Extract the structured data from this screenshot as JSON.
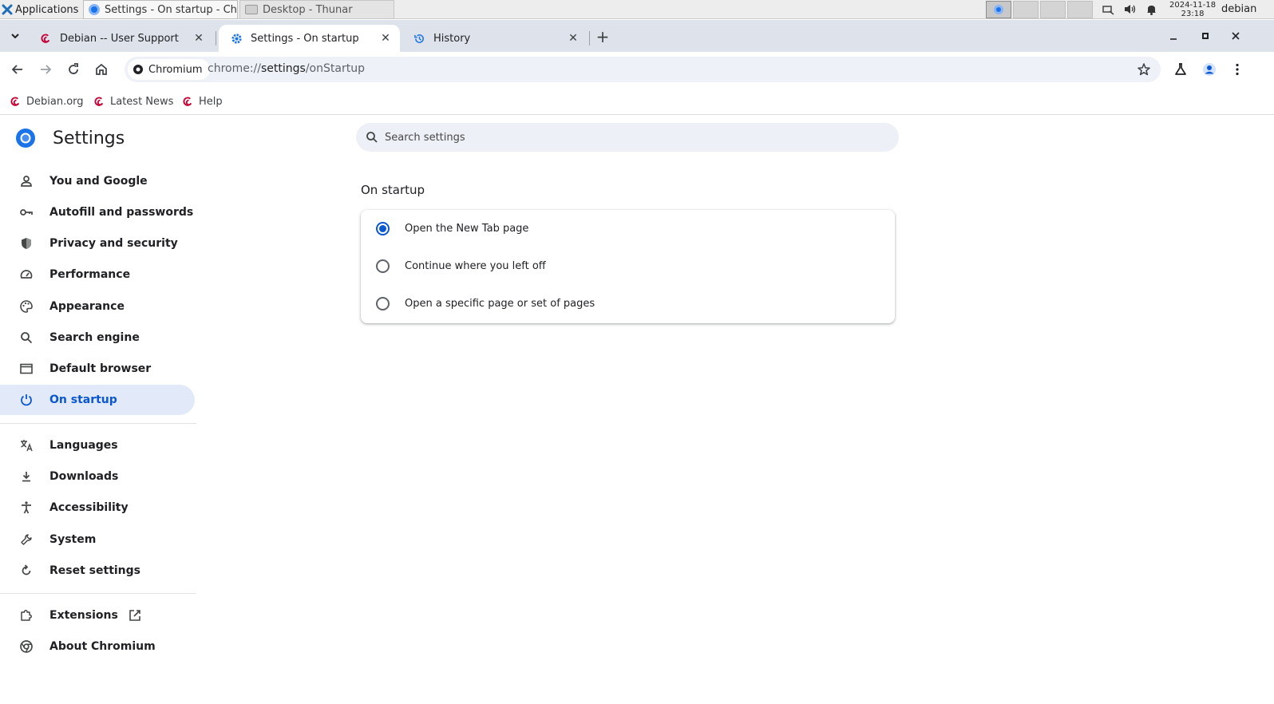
{
  "desktop_panel": {
    "applications_label": "Applications",
    "tasks": [
      {
        "title": "Settings - On startup - Chr..."
      },
      {
        "title": "Desktop - Thunar"
      }
    ],
    "clock_date": "2024-11-18",
    "clock_time": "23:18",
    "user": "debian"
  },
  "browser": {
    "tabs": [
      {
        "title": "Debian -- User Support",
        "favicon": "debian-swirl-icon"
      },
      {
        "title": "Settings - On startup",
        "favicon": "gear-icon",
        "active": true
      },
      {
        "title": "History",
        "favicon": "history-icon"
      }
    ],
    "omnibox": {
      "chip_label": "Chromium",
      "url_scheme": "chrome://",
      "url_host": "settings",
      "url_path": "/onStartup"
    },
    "bookmarks": [
      {
        "label": "Debian.org"
      },
      {
        "label": "Latest News"
      },
      {
        "label": "Help"
      }
    ]
  },
  "settings": {
    "title": "Settings",
    "search_placeholder": "Search settings",
    "nav": [
      {
        "label": "You and Google",
        "icon": "person-icon"
      },
      {
        "label": "Autofill and passwords",
        "icon": "key-icon"
      },
      {
        "label": "Privacy and security",
        "icon": "shield-icon"
      },
      {
        "label": "Performance",
        "icon": "speedometer-icon"
      },
      {
        "label": "Appearance",
        "icon": "palette-icon"
      },
      {
        "label": "Search engine",
        "icon": "search-icon"
      },
      {
        "label": "Default browser",
        "icon": "browser-window-icon"
      },
      {
        "label": "On startup",
        "icon": "power-icon",
        "active": true
      },
      {
        "label": "Languages",
        "icon": "translate-icon"
      },
      {
        "label": "Downloads",
        "icon": "download-icon"
      },
      {
        "label": "Accessibility",
        "icon": "accessibility-icon"
      },
      {
        "label": "System",
        "icon": "wrench-icon"
      },
      {
        "label": "Reset settings",
        "icon": "reset-icon"
      },
      {
        "label": "Extensions",
        "icon": "puzzle-icon"
      },
      {
        "label": "About Chromium",
        "icon": "chromium-icon"
      }
    ],
    "section_title": "On startup",
    "options": [
      {
        "label": "Open the New Tab page",
        "selected": true
      },
      {
        "label": "Continue where you left off",
        "selected": false
      },
      {
        "label": "Open a specific page or set of pages",
        "selected": false
      }
    ]
  },
  "colors": {
    "accent": "#0b57d0",
    "active_nav_bg": "#e2e9f8",
    "tabstrip_bg": "#dee3eb"
  }
}
